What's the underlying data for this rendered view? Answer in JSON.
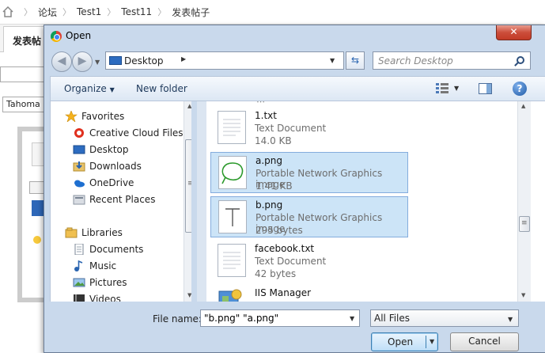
{
  "page": {
    "breadcrumb": [
      "论坛",
      "Test1",
      "Test11",
      "发表帖子"
    ],
    "active_tab": "发表帖",
    "font_select": "Tahoma"
  },
  "dialog": {
    "title": "Open",
    "close_label": "✕",
    "address": {
      "location": "Desktop"
    },
    "search_placeholder": "Search Desktop",
    "toolbar": {
      "organize": "Organize",
      "new_folder": "New folder",
      "help": "?"
    },
    "nav": {
      "items": [
        {
          "label": "Favorites",
          "icon": "star-icon"
        },
        {
          "label": "Creative Cloud Files",
          "icon": "creative-cloud-icon"
        },
        {
          "label": "Desktop",
          "icon": "desktop-icon"
        },
        {
          "label": "Downloads",
          "icon": "downloads-icon"
        },
        {
          "label": "OneDrive",
          "icon": "onedrive-icon"
        },
        {
          "label": "Recent Places",
          "icon": "recent-places-icon"
        },
        {
          "label": "Libraries",
          "icon": "libraries-icon"
        },
        {
          "label": "Documents",
          "icon": "documents-icon"
        },
        {
          "label": "Music",
          "icon": "music-icon"
        },
        {
          "label": "Pictures",
          "icon": "pictures-icon"
        },
        {
          "label": "Videos",
          "icon": "videos-icon"
        }
      ]
    },
    "files": [
      {
        "name": "1.txt",
        "type": "Text Document",
        "size": "14.0 KB",
        "selected": false
      },
      {
        "name": "a.png",
        "type": "Portable Network Graphics image",
        "size": "1.41 KB",
        "selected": true
      },
      {
        "name": "b.png",
        "type": "Portable Network Graphics image",
        "size": "295 bytes",
        "selected": true
      },
      {
        "name": "facebook.txt",
        "type": "Text Document",
        "size": "42 bytes",
        "selected": false
      },
      {
        "name": "IIS Manager",
        "type": "",
        "size": "",
        "selected": false
      }
    ],
    "file_name_label": "File name:",
    "file_name_value": "\"b.png\" \"a.png\"",
    "filter": "All Files",
    "open_label": "Open",
    "cancel_label": "Cancel"
  },
  "colors": {
    "accent": "#2e67b8",
    "selection": "#cce4f7",
    "selection_border": "#84acdd",
    "close_red": "#c23a26"
  }
}
